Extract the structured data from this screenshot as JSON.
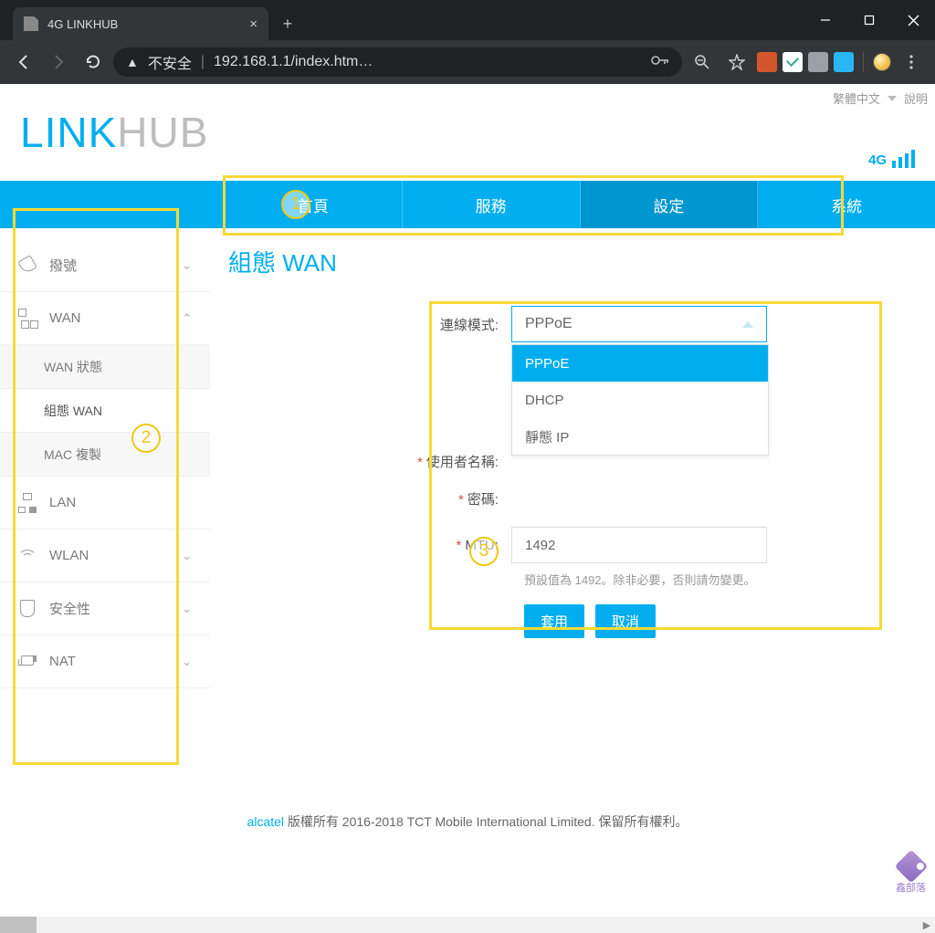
{
  "browser": {
    "tab_title": "4G LINKHUB",
    "url_prefix": "不安全",
    "url": "192.168.1.1/index.htm…"
  },
  "header": {
    "logo_part1": "LINK",
    "logo_part2": "HUB",
    "lang": "繁體中文",
    "help": "說明",
    "signal_label": "4G"
  },
  "nav": {
    "home": "首頁",
    "services": "服務",
    "settings": "設定",
    "system": "系統"
  },
  "sidebar": {
    "dial": "撥號",
    "wan": "WAN",
    "wan_sub": {
      "status": "WAN 狀態",
      "config": "組態 WAN",
      "mac": "MAC 複製"
    },
    "lan": "LAN",
    "wlan": "WLAN",
    "security": "安全性",
    "nat": "NAT"
  },
  "main": {
    "title": "組態 WAN",
    "conn_mode_label": "連線模式:",
    "conn_mode_value": "PPPoE",
    "dropdown": {
      "opt1": "PPPoE",
      "opt2": "DHCP",
      "opt3": "靜態 IP"
    },
    "username_label": "使用者名稱:",
    "password_label": "密碼:",
    "mtu_label": "MTU:",
    "mtu_value": "1492",
    "mtu_hint": "預設值為 1492。除非必要，否則請勿變更。",
    "apply": "套用",
    "cancel": "取消"
  },
  "footer": {
    "brand": "alcatel",
    "text": " 版權所有 2016-2018 TCT Mobile International Limited. 保留所有權利。"
  },
  "annotations": {
    "n1": "1",
    "n2": "2",
    "n3": "3"
  },
  "watermark": "鑫部落"
}
